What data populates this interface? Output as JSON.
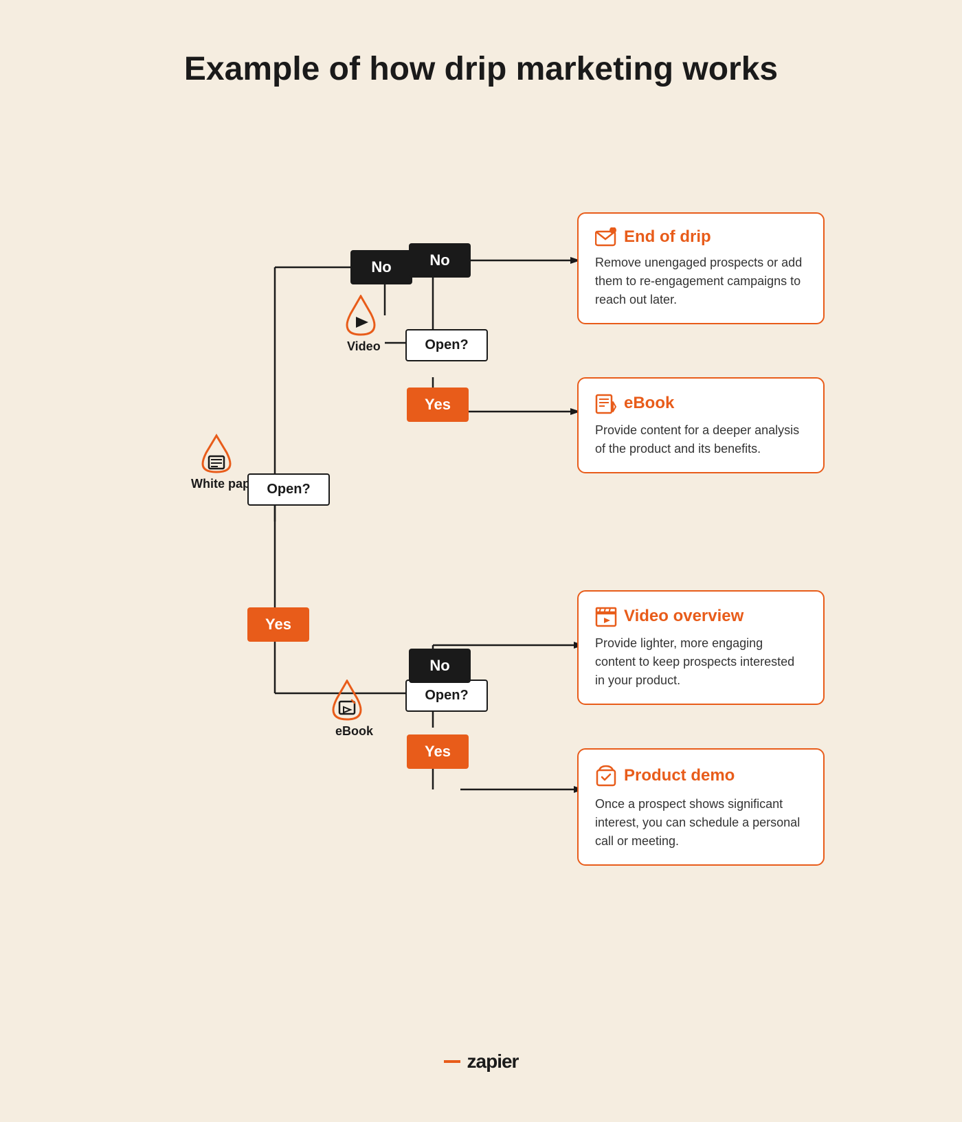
{
  "title": "Example of how drip marketing works",
  "nodes": {
    "white_paper_label": "White paper",
    "open_q1": "Open?",
    "no1": "No",
    "yes1": "Yes",
    "video_label": "Video",
    "open_q2": "Open?",
    "no2": "No",
    "yes2": "Yes",
    "ebook_label": "eBook",
    "open_q3": "Open?",
    "no3": "No",
    "yes3": "Yes"
  },
  "cards": {
    "end_of_drip": {
      "title": "End of drip",
      "text": "Remove unengaged prospects or add them to re-engagement campaigns to reach out later."
    },
    "ebook": {
      "title": "eBook",
      "text": "Provide content for a deeper analysis of the product and its benefits."
    },
    "video_overview": {
      "title": "Video overview",
      "text": "Provide lighter, more engaging content to keep prospects interested in your product."
    },
    "product_demo": {
      "title": "Product demo",
      "text": "Once a prospect shows significant interest, you can schedule a personal call or meeting."
    }
  },
  "logo": {
    "dash": "—",
    "text": "zapier"
  }
}
